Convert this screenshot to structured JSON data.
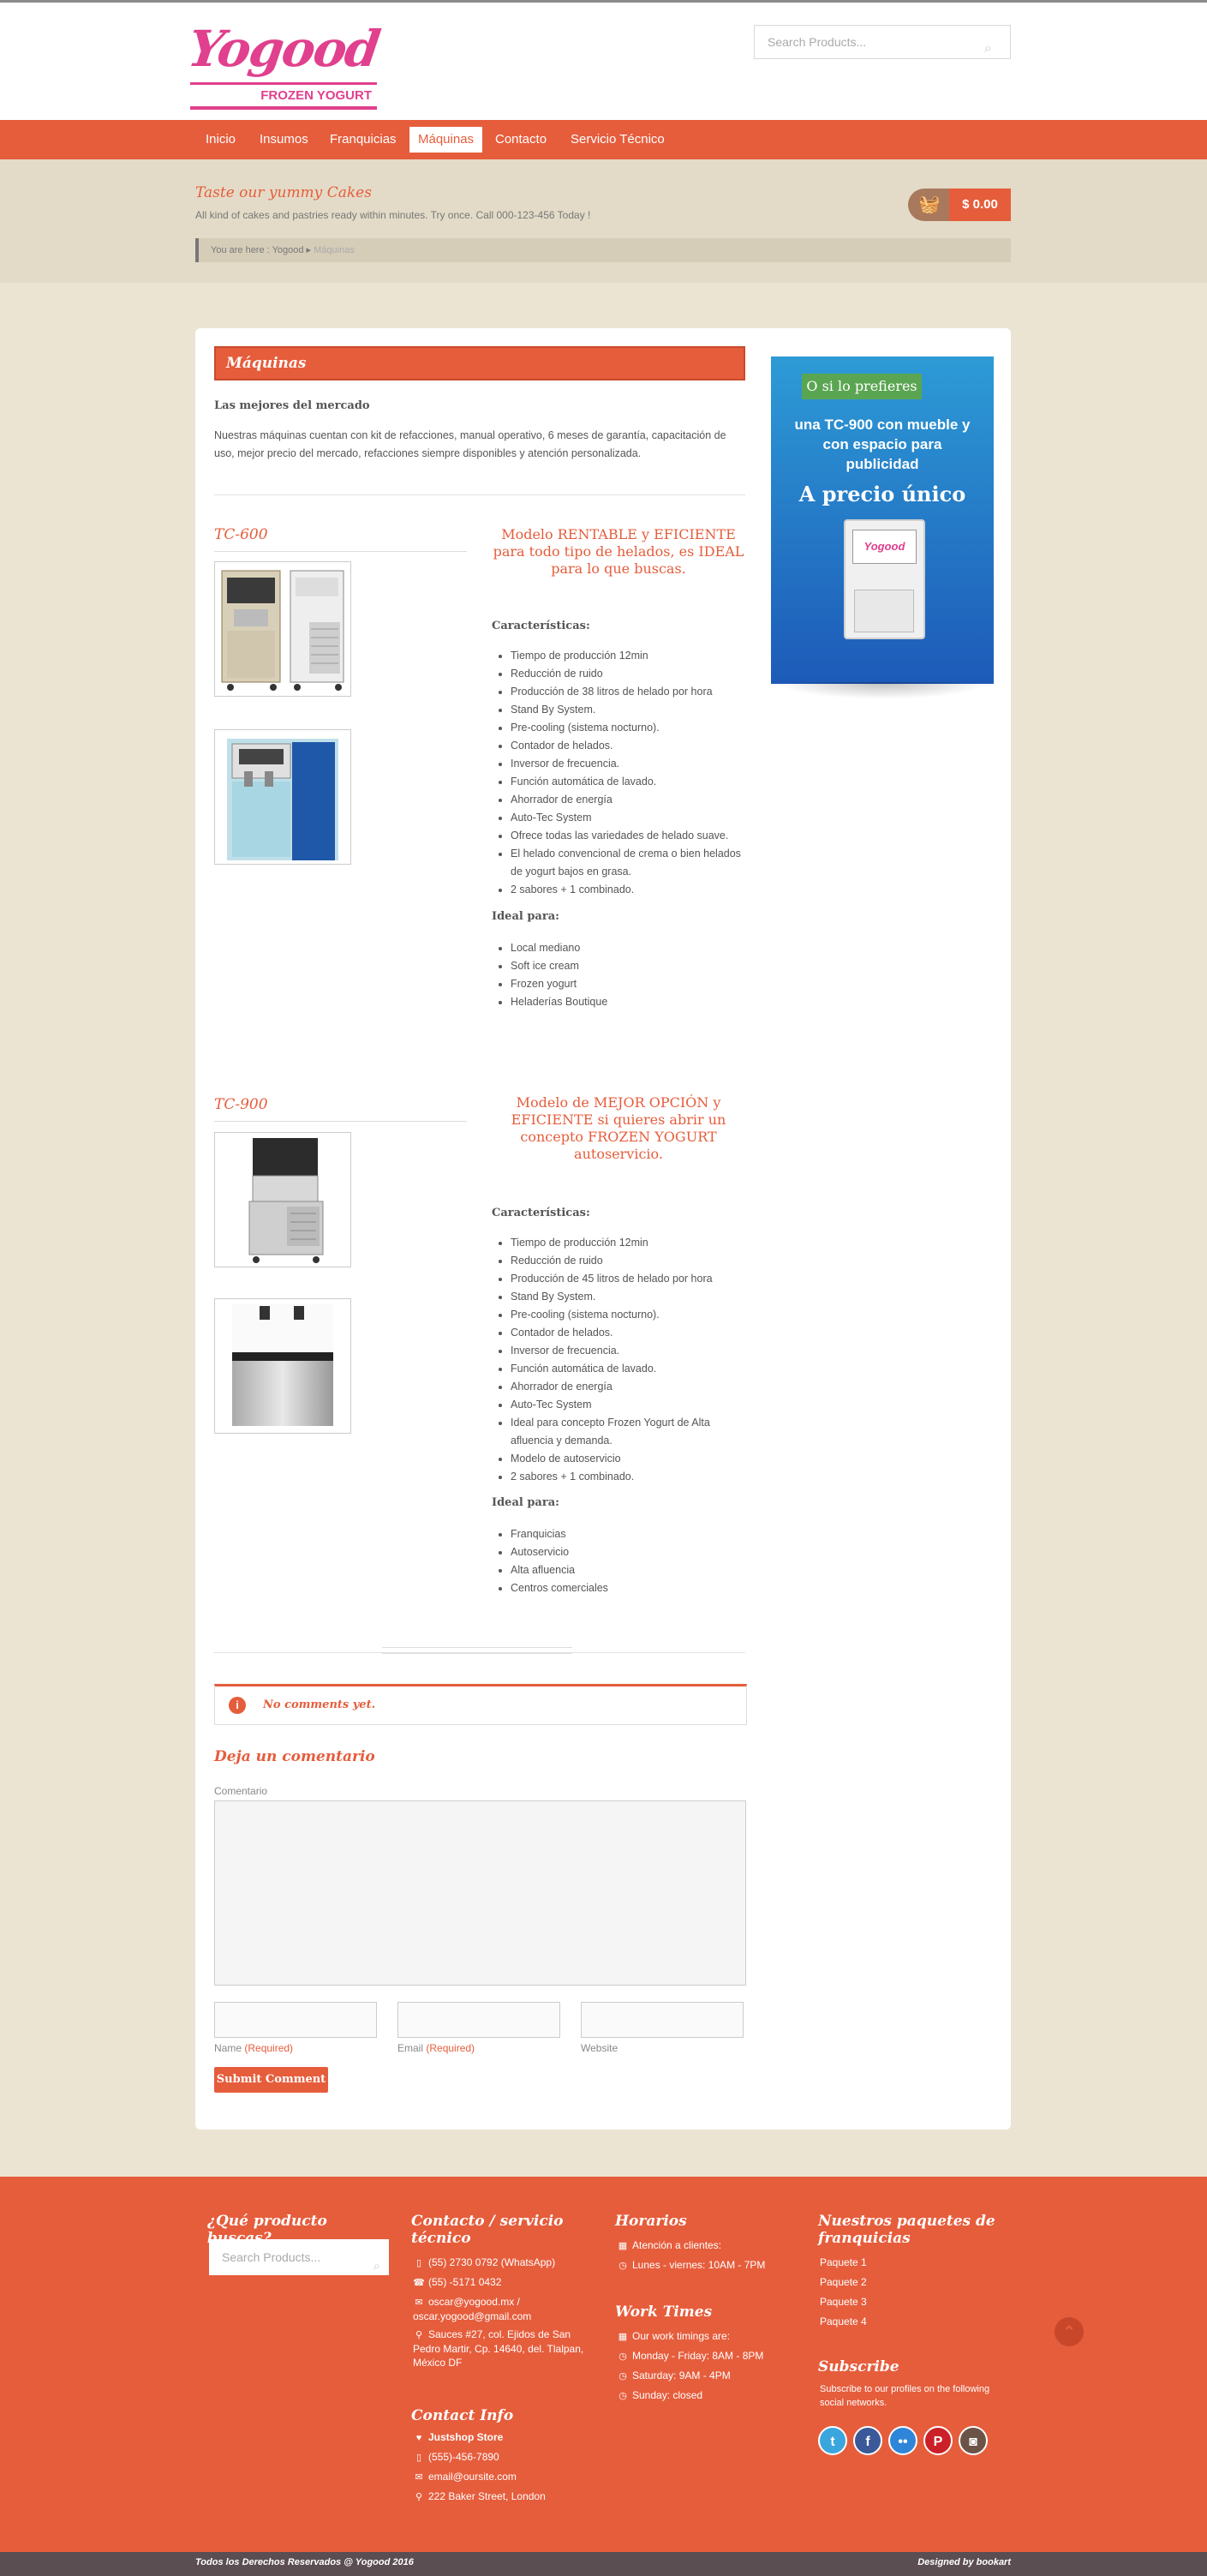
{
  "header": {
    "logo_text": "Yogood",
    "logo_sub": "FROZEN YOGURT",
    "search_placeholder": "Search Products..."
  },
  "nav": {
    "items": [
      "Inicio",
      "Insumos",
      "Franquicias",
      "Máquinas",
      "Contacto",
      "Servicio Técnico"
    ],
    "active": "Máquinas"
  },
  "banner": {
    "title": "Taste our yummy Cakes",
    "text": "All kind of cakes and pastries ready within minutes. Try once. Call 000-123-456 Today !",
    "cart_total": "$ 0.00"
  },
  "breadcrumb": {
    "prefix": "You are here :",
    "home": "Yogood",
    "current": "Máquinas"
  },
  "page": {
    "title": "Máquinas",
    "intro_title": "Las mejores del mercado",
    "intro_text": "Nuestras máquinas cuentan con kit de refacciones, manual operativo, 6 meses de garantía, capacitación de uso, mejor precio del mercado, refacciones siempre disponibles y atención personalizada."
  },
  "products": [
    {
      "name": "TC-600",
      "description": "Modelo RENTABLE y EFICIENTE para todo tipo de helados, es IDEAL para lo que buscas.",
      "features_title": "Características:",
      "features": [
        "Tiempo de producción 12min",
        "Reducción de ruido",
        "Producción de 38 litros de helado por hora",
        "Stand By System.",
        "Pre-cooling (sistema nocturno).",
        "Contador de helados.",
        "Inversor de frecuencia.",
        "Función automática de lavado.",
        "Ahorrador de energía",
        "Auto-Tec System",
        "Ofrece todas las variedades de helado suave.",
        "El helado convencional de crema o bien helados de yogurt bajos en grasa.",
        "2 sabores + 1 combinado."
      ],
      "ideal_title": "Ideal para:",
      "ideal": [
        "Local mediano",
        "Soft ice cream",
        "Frozen yogurt",
        "Heladerías Boutique"
      ]
    },
    {
      "name": "TC-900",
      "description": "Modelo de MEJOR OPCIÓN y EFICIENTE si quieres abrir un concepto FROZEN YOGURT autoservicio.",
      "features_title": "Características:",
      "features": [
        "Tiempo de producción 12min",
        "Reducción de ruido",
        "Producción de 45 litros de helado por hora",
        "Stand By System.",
        "Pre-cooling (sistema nocturno).",
        "Contador de helados.",
        "Inversor de frecuencia.",
        "Función automática de lavado.",
        "Ahorrador de energía",
        "Auto-Tec System",
        "Ideal para concepto Frozen Yogurt de Alta afluencia y demanda.",
        "Modelo de autoservicio",
        "2 sabores + 1 combinado."
      ],
      "ideal_title": "Ideal para:",
      "ideal": [
        "Franquicias",
        "Autoservicio",
        "Alta afluencia",
        "Centros comerciales"
      ]
    }
  ],
  "ad": {
    "badge": "O si lo prefieres",
    "line1": "una TC-900 con mueble y con espacio para publicidad",
    "line2": "A precio único"
  },
  "comments": {
    "none": "No comments yet.",
    "reply_title": "Deja un comentario",
    "comment_label": "Comentario",
    "name_label": "Name",
    "email_label": "Email",
    "website_label": "Website",
    "required": "(Required)",
    "submit": "Submit Comment"
  },
  "footer": {
    "col1_title": "¿Qué producto buscas?",
    "search_placeholder": "Search Products...",
    "col2_title": "Contacto / servicio técnico",
    "contact": [
      "(55) 2730 0792 (WhatsApp)",
      "(55) -5171 0432",
      "oscar@yogood.mx / oscar.yogood@gmail.com",
      "Sauces #27, col. Ejidos de San Pedro Martir, Cp. 14640, del. Tlalpan, México DF"
    ],
    "contact_info_title": "Contact Info",
    "contact_info": [
      "Justshop Store",
      "(555)-456-7890",
      "email@oursite.com",
      "222 Baker Street, London"
    ],
    "col3_title": "Horarios",
    "horarios": [
      "Atención a clientes:",
      "Lunes - viernes: 10AM - 7PM"
    ],
    "work_title": "Work Times",
    "work": [
      "Our work timings are:",
      "Monday - Friday: 8AM - 8PM",
      "Saturday: 9AM - 4PM",
      "Sunday: closed"
    ],
    "col4_title": "Nuestros paquetes de franquicias",
    "paquetes": [
      "Paquete 1",
      "Paquete 2",
      "Paquete 3",
      "Paquete 4"
    ],
    "subscribe_title": "Subscribe",
    "subscribe_text": "Subscribe to our profiles on the following social networks.",
    "social": [
      "twitter-icon",
      "facebook-icon",
      "flickr-icon",
      "pinterest-icon",
      "instagram-icon"
    ]
  },
  "bottom": {
    "copyright": "Todos los Derechos Reservados @ Yogood 2016",
    "designed": "Designed by bookart"
  },
  "colors": {
    "accent": "#e65d3c",
    "logo_pink": "#e0408e",
    "background": "#ece4d2"
  }
}
